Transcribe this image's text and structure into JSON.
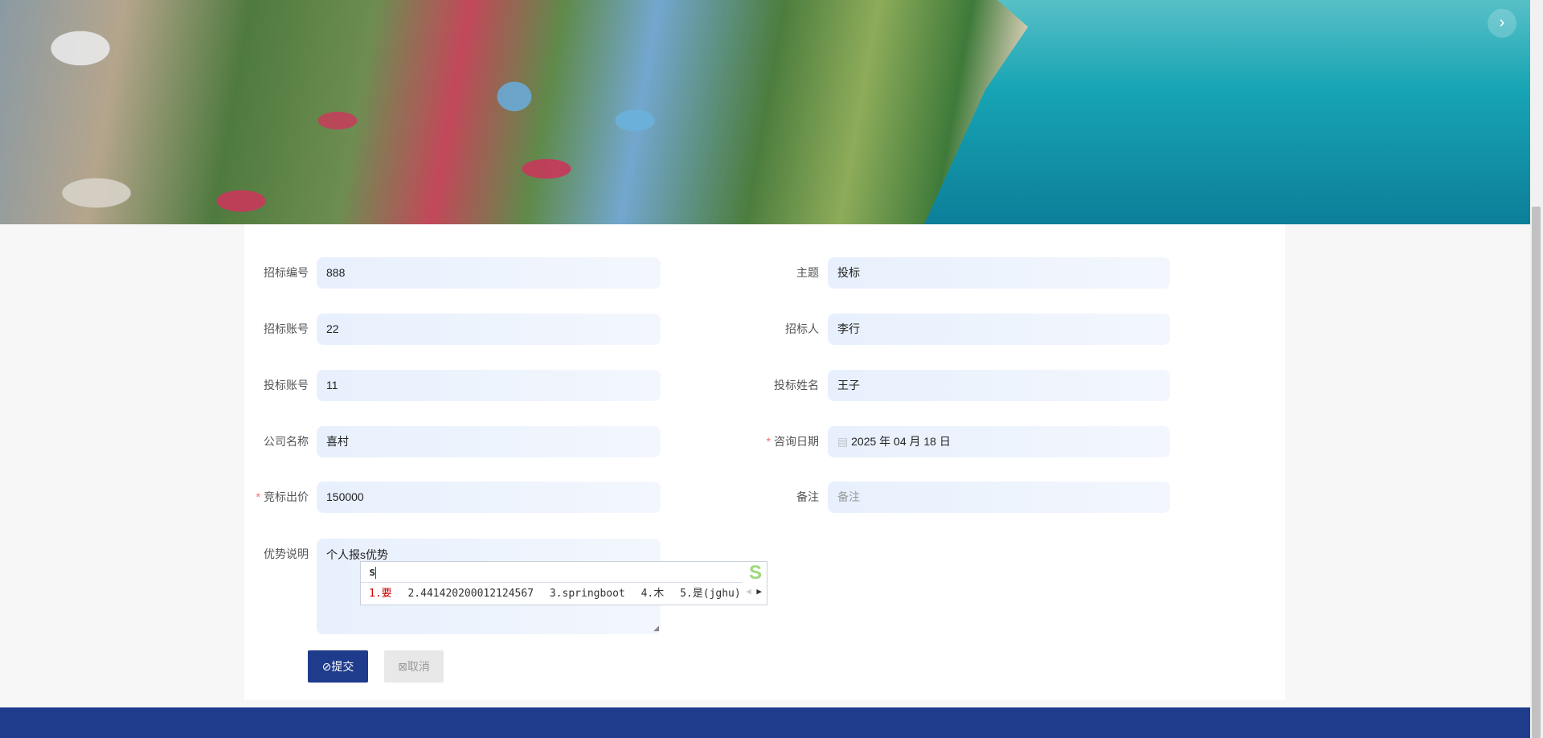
{
  "banner": {
    "next_icon": "chevron-right-icon",
    "next_glyph": "›"
  },
  "form": {
    "left": [
      {
        "label": "招标编号",
        "value": "888",
        "required": false
      },
      {
        "label": "招标账号",
        "value": "22",
        "required": false
      },
      {
        "label": "投标账号",
        "value": "11",
        "required": false
      },
      {
        "label": "公司名称",
        "value": "喜村",
        "required": false
      },
      {
        "label": "竞标出价",
        "value": "150000",
        "required": true
      }
    ],
    "right": [
      {
        "label": "主题",
        "value": "投标",
        "required": false
      },
      {
        "label": "招标人",
        "value": "李行",
        "required": false
      },
      {
        "label": "投标姓名",
        "value": "王子",
        "required": false
      },
      {
        "label": "咨询日期",
        "value": "2025 年 04 月 18 日",
        "required": true
      },
      {
        "label": "备注",
        "value": "",
        "placeholder": "备注",
        "required": false
      }
    ],
    "advantage": {
      "label": "优势说明",
      "value": "个人报s优势"
    },
    "submit_label": "⊘提交",
    "cancel_label": "⊠取消",
    "required_mark": "*"
  },
  "ime": {
    "composition": "s",
    "candidates": [
      "1.要",
      "2.441420200012124567",
      "3.springboot",
      "4.木",
      "5.是(jghu)"
    ],
    "logo": "S"
  },
  "colors": {
    "primary": "#1f3b8b",
    "input_bg": "#e8f0fd",
    "required": "#f56c6c"
  }
}
